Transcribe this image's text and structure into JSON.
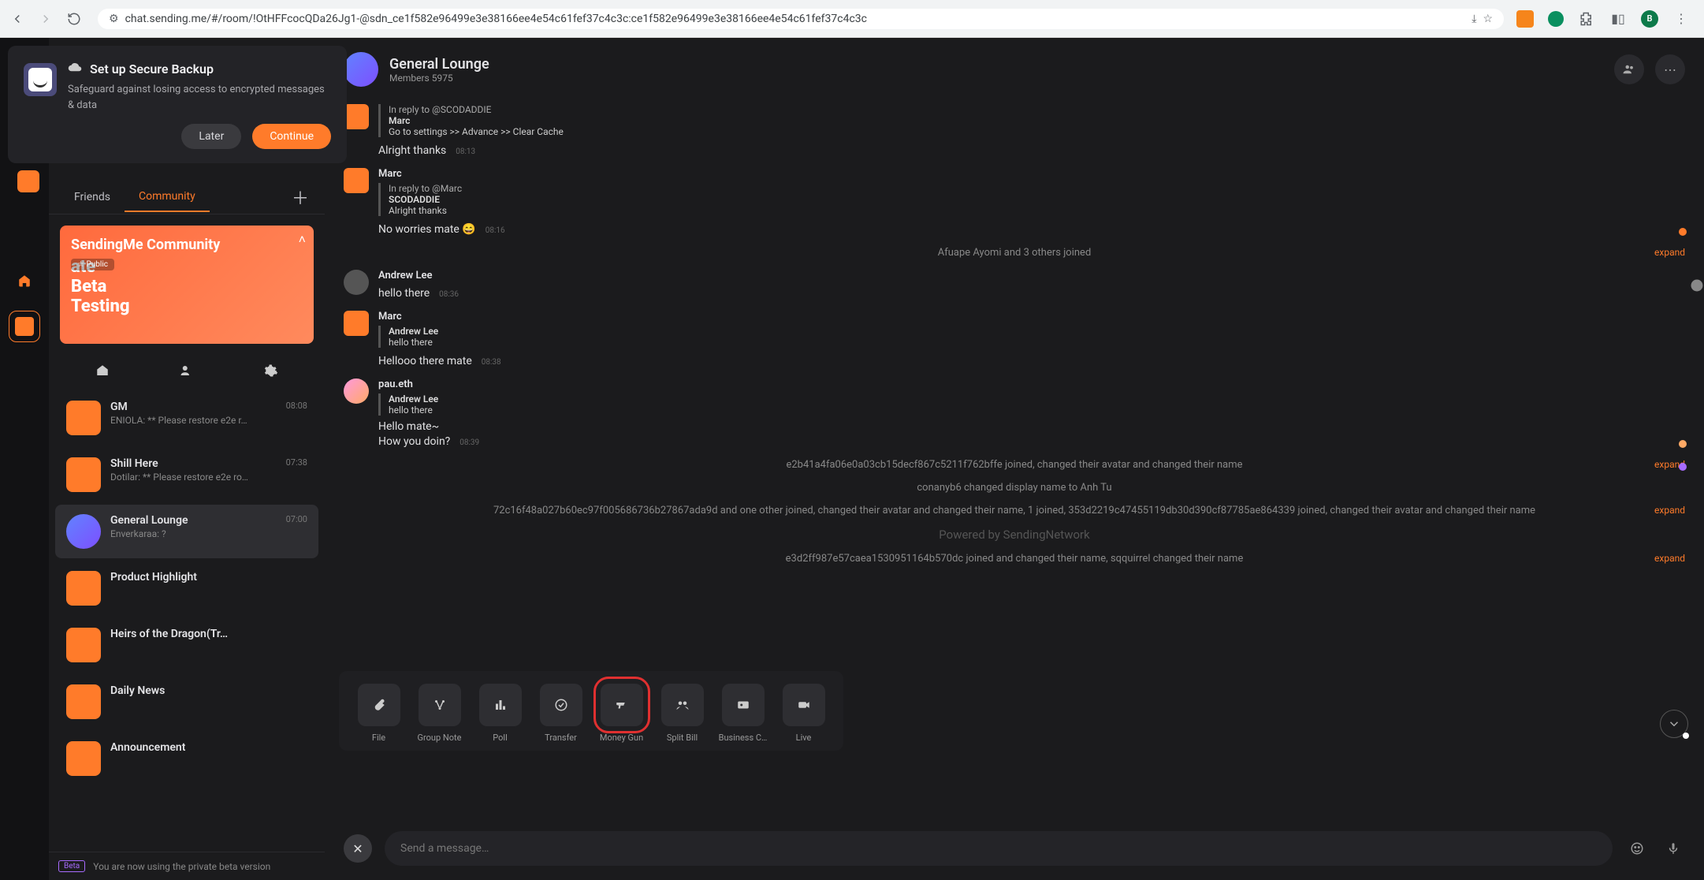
{
  "browser": {
    "url": "chat.sending.me/#/room/!OtHFFcocQDa26Jg1-@sdn_ce1f582e96499e3e38166ee4e54c61fef37c4c3c:ce1f582e96499e3e38166ee4e54c61fef37c4c3c",
    "profile_initial": "B"
  },
  "backup_modal": {
    "title": "Set up Secure Backup",
    "text": "Safeguard against losing access to encrypted messages & data",
    "later": "Later",
    "continue": "Continue"
  },
  "side_tabs": {
    "friends": "Friends",
    "community": "Community"
  },
  "banner": {
    "title": "SendingMe Community",
    "line2": "ate",
    "line3": "Beta",
    "line4": "Testing",
    "pill": "☆ Public"
  },
  "rooms": [
    {
      "name": "GM",
      "time": "08:08",
      "preview": "ENIOLA: ** Please restore e2e r…"
    },
    {
      "name": "Shill Here",
      "time": "07:38",
      "preview": "Dotilar: ** Please restore e2e ro…"
    },
    {
      "name": "General Lounge",
      "time": "07:00",
      "preview": "Enverkaraa: ?"
    },
    {
      "name": "Product Highlight",
      "time": "",
      "preview": ""
    },
    {
      "name": "Heirs of the Dragon(Tr…",
      "time": "",
      "preview": ""
    },
    {
      "name": "Daily News",
      "time": "",
      "preview": ""
    },
    {
      "name": "Announcement",
      "time": "",
      "preview": ""
    }
  ],
  "beta": {
    "badge": "Beta",
    "text": "You are now using the private beta version"
  },
  "header": {
    "title": "General Lounge",
    "members": "Members 5975"
  },
  "messages": {
    "m1": {
      "reply_to": "In reply to @SCODADDIE",
      "reply_name": "Marc",
      "reply_text": "Go to settings >> Advance >> Clear Cache",
      "text": "Alright thanks",
      "time": "08:13"
    },
    "m2": {
      "sender": "Marc",
      "reply_to": "In reply to @Marc",
      "reply_name": "SCODADDIE",
      "reply_text": "Alright thanks",
      "text": "No worries mate 😄",
      "time": "08:16"
    },
    "sys1": {
      "text": "Afuape Ayomi and 3 others joined",
      "expand": "expand"
    },
    "m3": {
      "sender": "Andrew Lee",
      "text": "hello there",
      "time": "08:36"
    },
    "m4": {
      "sender": "Marc",
      "reply_name": "Andrew Lee",
      "reply_text": "hello there",
      "text": "Hellooo there mate",
      "time": "08:38"
    },
    "m5": {
      "sender": "pau.eth",
      "reply_name": "Andrew Lee",
      "reply_text": "hello there",
      "text_l1": "Hello mate~",
      "text_l2": "How you doin?",
      "time": "08:39"
    },
    "sys2": {
      "text": "e2b41a4fa06e0a03cb15decf867c5211f762bffe joined, changed their avatar and changed their name",
      "expand": "expand"
    },
    "sys3": {
      "text": "conanyb6 changed display name to Anh Tu"
    },
    "sys4": {
      "text": "72c16f48a027b60ec97f005686736b27867ada9d and one other joined, changed their avatar and changed their name, 1 joined, 353d2219c47455119db30d390cf87785ae864339 joined, changed their avatar and changed their name",
      "expand": "expand"
    },
    "powered": "Powered by SendingNetwork",
    "sys5": {
      "text": "e3d2ff987e57caea1530951164b570dc joined and changed their name, sqquirrel changed their name",
      "expand": "expand"
    }
  },
  "attach": {
    "file": "File",
    "group_note": "Group Note",
    "poll": "Poll",
    "transfer": "Transfer",
    "money_gun": "Money Gun",
    "split_bill": "Split Bill",
    "business_card": "Business C…",
    "live": "Live"
  },
  "compose": {
    "placeholder": "Send a message…"
  }
}
